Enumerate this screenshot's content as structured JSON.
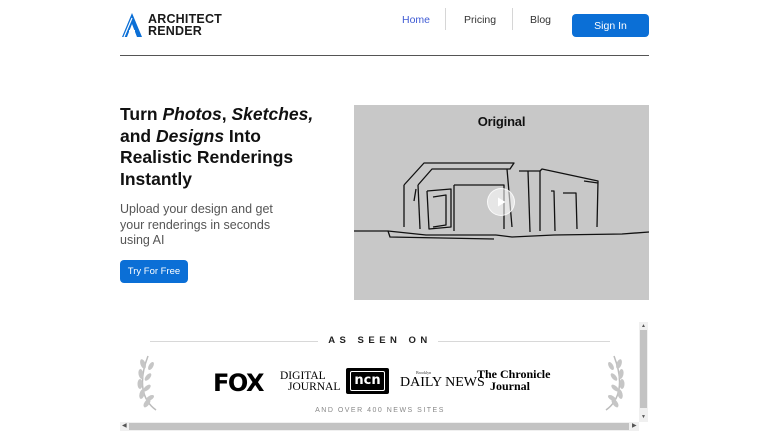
{
  "brand": {
    "line1": "ARCHITECT",
    "line2": "RENDER",
    "icon": "a-logo-icon",
    "color": "#0b6fd6"
  },
  "nav": {
    "items": [
      {
        "label": "Home",
        "active": true
      },
      {
        "label": "Pricing",
        "active": false
      },
      {
        "label": "Blog",
        "active": false
      }
    ],
    "signin_label": "Sign In"
  },
  "hero": {
    "title_parts": [
      "Turn ",
      "Photos",
      ", ",
      "Sketches,",
      "and ",
      "Designs",
      " Into",
      "Realistic Renderings",
      "Instantly"
    ],
    "subtitle": "Upload your design and get your renderings in seconds using AI",
    "cta_label": "Try For Free"
  },
  "video": {
    "label": "Original",
    "play_icon": "play-icon"
  },
  "press": {
    "heading": "AS SEEN ON",
    "logos": {
      "fox": "FOX",
      "digital_journal_1": "DIGITAL",
      "digital_journal_2": "JOURNAL",
      "ncn": "ncn",
      "daily_news": "DAILY NEWS",
      "daily_news_small": "Brooklyn",
      "chronicle_1": "The Chronicle",
      "chronicle_2": "Journal"
    },
    "footer": "AND OVER 400 NEWS SITES"
  }
}
